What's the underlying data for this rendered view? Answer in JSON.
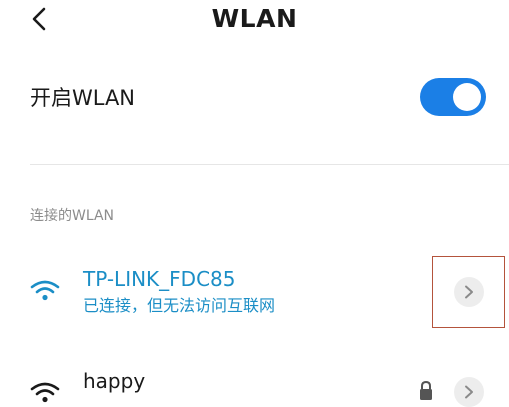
{
  "header": {
    "title": "WLAN",
    "back_icon": "back-chevron-icon"
  },
  "wlan_toggle": {
    "label": "开启WLAN",
    "enabled": true,
    "color_on": "#1b7fe6"
  },
  "connected_section": {
    "header": "连接的WLAN"
  },
  "networks": [
    {
      "name": "TP-LINK_FDC85",
      "status": "已连接，但无法访问互联网",
      "color": "#1b8ec6",
      "icon": "wifi-icon",
      "detail_icon": "chevron-right-icon"
    },
    {
      "name": "happy",
      "status": "",
      "color": "#1a1a1a",
      "icon": "wifi-icon",
      "secured": true,
      "lock_icon": "lock-icon",
      "detail_icon": "chevron-right-icon"
    }
  ]
}
